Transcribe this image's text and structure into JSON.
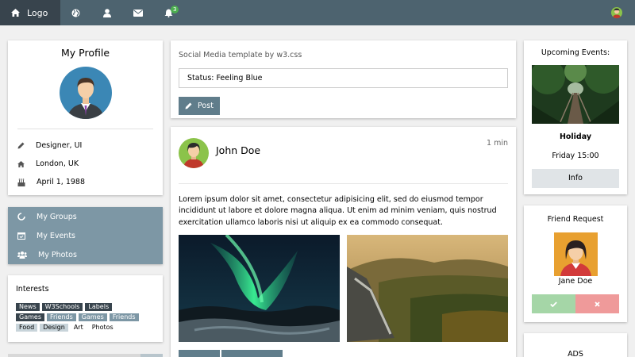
{
  "nav": {
    "logo": "Logo",
    "icons": [
      "home-icon",
      "globe-icon",
      "user-icon",
      "envelope-icon",
      "bell-icon"
    ],
    "notification_count": "3"
  },
  "profile": {
    "title": "My Profile",
    "job": "Designer, UI",
    "location": "London, UK",
    "birthday": "April 1, 1988"
  },
  "accordion": {
    "groups": "My Groups",
    "events": "My Events",
    "photos": "My Photos"
  },
  "interests": {
    "title": "Interests",
    "tags": [
      "News",
      "W3Schools",
      "Labels",
      "Games",
      "Friends",
      "Games",
      "Friends",
      "Food",
      "Design",
      "Art",
      "Photos"
    ]
  },
  "status": {
    "heading": "Social Media template by w3.css",
    "value": "Status: Feeling Blue",
    "post_label": "Post"
  },
  "post": {
    "author": "John Doe",
    "time": "1 min",
    "text": "Lorem ipsum dolor sit amet, consectetur adipisicing elit, sed do eiusmod tempor incididunt ut labore et dolore magna aliqua. Ut enim ad minim veniam, quis nostrud exercitation ullamco laboris nisi ut aliquip ex ea commodo consequat."
  },
  "events": {
    "title": "Upcoming Events:",
    "name": "Holiday",
    "time": "Friday 15:00",
    "button": "Info"
  },
  "friend": {
    "title": "Friend Request",
    "name": "Jane Doe"
  },
  "ads": {
    "title": "ADS"
  },
  "colors": {
    "nav_bg": "#4d636f",
    "nav_dark": "#38444d",
    "accent": "#607d8b",
    "accordion": "#7d97a5",
    "accept": "#a5d6a7",
    "decline": "#ef9a9a",
    "badge": "#4caf50"
  }
}
